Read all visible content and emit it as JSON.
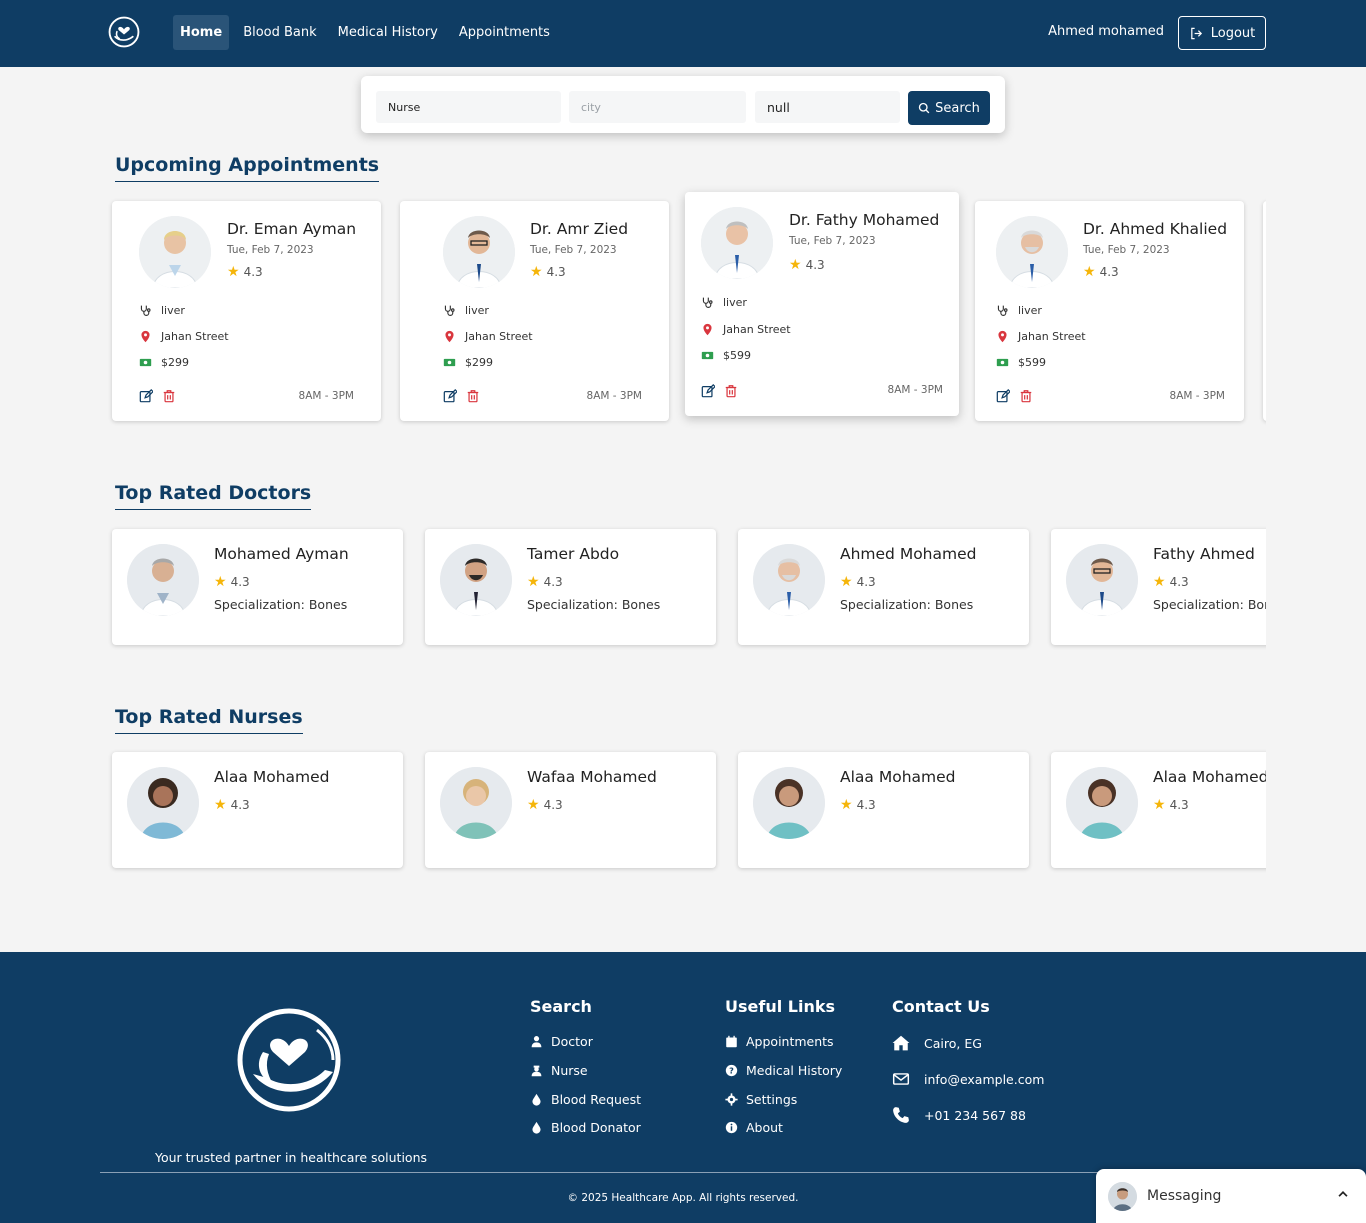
{
  "nav": {
    "links": [
      {
        "label": "Home",
        "active": true
      },
      {
        "label": "Blood Bank",
        "active": false
      },
      {
        "label": "Medical History",
        "active": false
      },
      {
        "label": "Appointments",
        "active": false
      }
    ],
    "user_name": "Ahmed mohamed",
    "logout_label": "Logout"
  },
  "search": {
    "type_value": "Nurse",
    "city_placeholder": "city",
    "third_value": "null",
    "button_label": "Search"
  },
  "sections": {
    "upcoming_title": "Upcoming Appointments",
    "doctors_title": "Top Rated Doctors",
    "nurses_title": "Top Rated Nurses"
  },
  "appointments": [
    {
      "name": "Dr. Eman Ayman",
      "date": "Tue, Feb 7, 2023",
      "rating": "4.3",
      "specialty": "liver",
      "address": "Jahan Street",
      "price": "$299",
      "time": "8AM - 3PM"
    },
    {
      "name": "Dr. Amr Zied",
      "date": "Tue, Feb 7, 2023",
      "rating": "4.3",
      "specialty": "liver",
      "address": "Jahan Street",
      "price": "$299",
      "time": "8AM - 3PM"
    },
    {
      "name": "Dr. Fathy Mohamed",
      "date": "Tue, Feb 7, 2023",
      "rating": "4.3",
      "specialty": "liver",
      "address": "Jahan Street",
      "price": "$599",
      "time": "8AM - 3PM"
    },
    {
      "name": "Dr. Ahmed Khalied",
      "date": "Tue, Feb 7, 2023",
      "rating": "4.3",
      "specialty": "liver",
      "address": "Jahan Street",
      "price": "$599",
      "time": "8AM - 3PM"
    }
  ],
  "doctors": [
    {
      "name": "Mohamed Ayman",
      "rating": "4.3",
      "specialization": "Specialization: Bones"
    },
    {
      "name": "Tamer Abdo",
      "rating": "4.3",
      "specialization": "Specialization: Bones"
    },
    {
      "name": "Ahmed Mohamed",
      "rating": "4.3",
      "specialization": "Specialization: Bones"
    },
    {
      "name": "Fathy Ahmed",
      "rating": "4.3",
      "specialization": "Specialization: Bones"
    }
  ],
  "nurses": [
    {
      "name": "Alaa Mohamed",
      "rating": "4.3"
    },
    {
      "name": "Wafaa Mohamed",
      "rating": "4.3"
    },
    {
      "name": "Alaa Mohamed",
      "rating": "4.3"
    },
    {
      "name": "Alaa Mohamed",
      "rating": "4.3"
    }
  ],
  "footer": {
    "tagline": "Your trusted partner in healthcare solutions",
    "search_title": "Search",
    "search_links": [
      "Doctor",
      "Nurse",
      "Blood Request",
      "Blood Donator"
    ],
    "useful_title": "Useful Links",
    "useful_links": [
      "Appointments",
      "Medical History",
      "Settings",
      "About"
    ],
    "contact_title": "Contact Us",
    "contact_items": [
      "Cairo, EG",
      "info@example.com",
      "+01 234 567 88"
    ],
    "copyright": "© 2025 Healthcare App. All rights reserved."
  },
  "messaging": {
    "label": "Messaging"
  },
  "colors": {
    "primary": "#0f3d64",
    "star": "#f5b50a",
    "danger": "#d9363e",
    "money": "#2e9e4f"
  }
}
